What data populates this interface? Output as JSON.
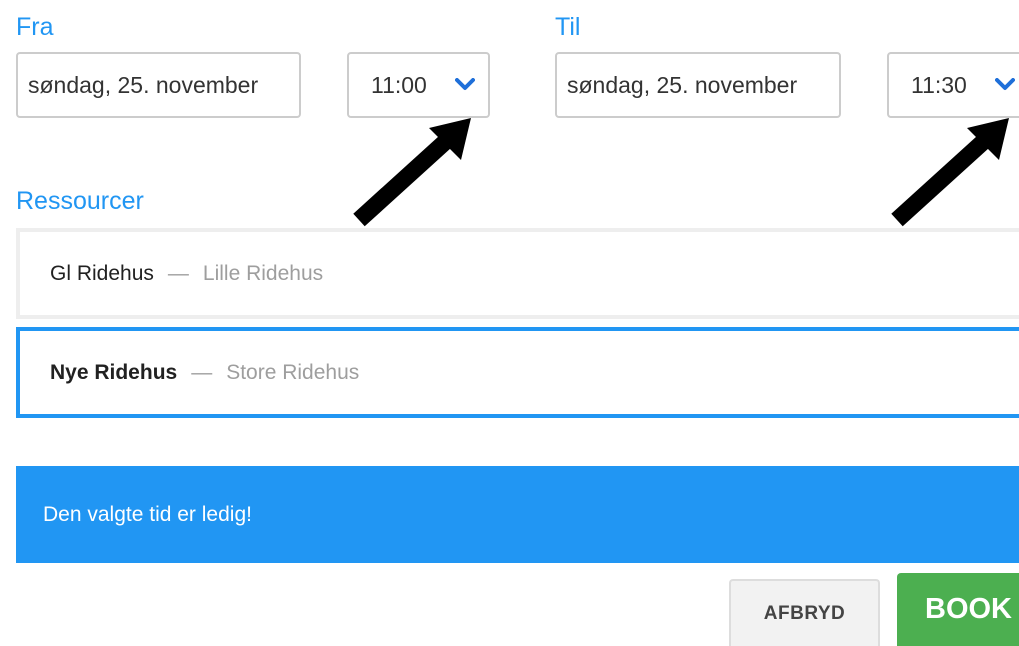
{
  "from": {
    "label": "Fra",
    "date": "søndag, 25. november",
    "time": "11:00"
  },
  "to": {
    "label": "Til",
    "date": "søndag, 25. november",
    "time": "11:30"
  },
  "resources": {
    "label": "Ressourcer",
    "items": [
      {
        "name": "Gl Ridehus",
        "sub": "Lille Ridehus",
        "selected": false
      },
      {
        "name": "Nye Ridehus",
        "sub": "Store Ridehus",
        "selected": true
      }
    ]
  },
  "alert": {
    "text": "Den valgte tid er ledig!"
  },
  "actions": {
    "cancel_label": "AFBRYD",
    "book_label": "BOOK"
  },
  "colors": {
    "accent": "#2196f3",
    "book": "#4caf50",
    "chevron": "#1e6fd9"
  },
  "icons": {
    "time_dropdown": "chevron-down-icon",
    "annotation": "arrow-annotation"
  }
}
